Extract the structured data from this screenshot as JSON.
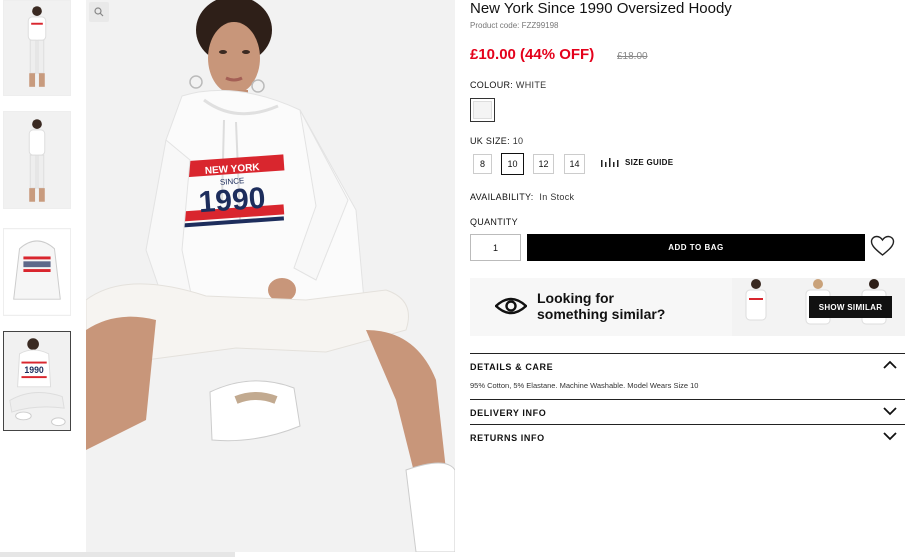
{
  "product": {
    "title": "New York Since 1990 Oversized Hoody",
    "code": "Product code: FZZ99198",
    "price": "£10.00 (44% OFF)",
    "old_price": "£18.00"
  },
  "colour": {
    "label": "COLOUR:",
    "value": "WHITE"
  },
  "size": {
    "label": "UK SIZE:",
    "value": "10",
    "options": [
      "8",
      "10",
      "12",
      "14"
    ],
    "guide_label": "SIZE GUIDE"
  },
  "availability": {
    "label": "AVAILABILITY:",
    "value": "In Stock"
  },
  "quantity": {
    "label": "QUANTITY",
    "value": "1"
  },
  "add_to_bag_label": "ADD TO BAG",
  "similar": {
    "line1": "Looking for",
    "line2": "something similar?",
    "button_label": "SHOW SIMILAR"
  },
  "accordion": [
    {
      "title": "DETAILS & CARE",
      "body": "95% Cotton, 5% Elastane. Machine Washable. Model Wears Size 10",
      "expanded": true
    },
    {
      "title": "DELIVERY INFO",
      "expanded": false
    },
    {
      "title": "RETURNS INFO",
      "expanded": false
    }
  ],
  "hoodie_print": {
    "top": "NEW YORK",
    "middle": "SINCE",
    "year": "1990"
  },
  "colors": {
    "sale": "#e4011b",
    "brand_black": "#000000",
    "stripe_red": "#d9262e",
    "stripe_navy": "#1d2d5c"
  },
  "icons": [
    "zoom-icon",
    "ruler-icon",
    "heart-icon",
    "eye-icon",
    "chevron-up-icon",
    "chevron-down-icon"
  ]
}
